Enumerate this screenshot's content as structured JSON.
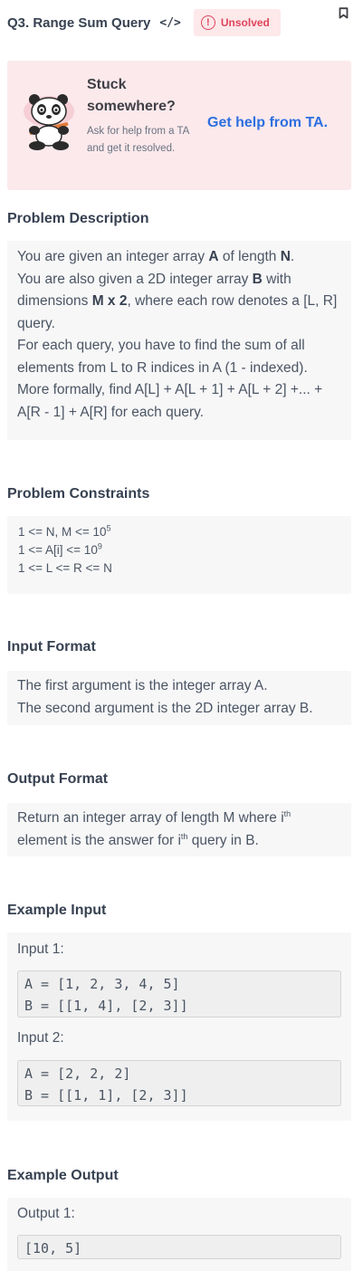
{
  "header": {
    "title": "Q3. Range Sum Query",
    "code_icon": "</>",
    "status": "Unsolved",
    "icons": [
      "code-icon",
      "alert-icon",
      "bookmark-icon"
    ]
  },
  "help": {
    "stuck_line1": "Stuck",
    "stuck_line2": "somewhere?",
    "sub": "Ask for help from a TA and get it resolved.",
    "link": "Get help from TA.",
    "link_color": "#2d6fe0",
    "card_color": "#fbe9ec"
  },
  "description": {
    "title": "Problem Description",
    "p1_a": "You are given an integer array ",
    "p1_b": "A",
    "p1_c": " of length ",
    "p1_d": "N",
    "p1_e": ".",
    "p2_a": "You are also given a 2D integer array ",
    "p2_b": "B",
    "p2_c": " with dimensions ",
    "p2_d": "M x 2",
    "p2_e": ", where each row denotes a [L, R] query.",
    "p3": "For each query, you have to find the sum of all elements from L to R indices in A (1 - indexed).",
    "p4": "More formally, find A[L] + A[L + 1] + A[L + 2] +... + A[R - 1] + A[R] for each query."
  },
  "constraints": {
    "title": "Problem Constraints",
    "c1": "1 <= N, M <= 10",
    "c1_exp": "5",
    "c2": "1 <= A[i] <= 10",
    "c2_exp": "9",
    "c3": "1 <= L <= R <= N"
  },
  "input_format": {
    "title": "Input Format",
    "line1": "The first argument is the integer array A.",
    "line2": "The second argument is the 2D integer array B."
  },
  "output_format": {
    "title": "Output Format",
    "a": "Return an integer array of length M where i",
    "sup1": "th",
    "b": " element is the answer for i",
    "sup2": "th",
    "c": " query in B."
  },
  "example_input": {
    "title": "Example Input",
    "label1": "Input 1:",
    "code1": "A = [1, 2, 3, 4, 5]\nB = [[1, 4], [2, 3]]",
    "label2": "Input 2:",
    "code2": "A = [2, 2, 2]\nB = [[1, 1], [2, 3]]"
  },
  "example_output": {
    "title": "Example Output",
    "label1": "Output 1:",
    "code1": "[10, 5]"
  }
}
